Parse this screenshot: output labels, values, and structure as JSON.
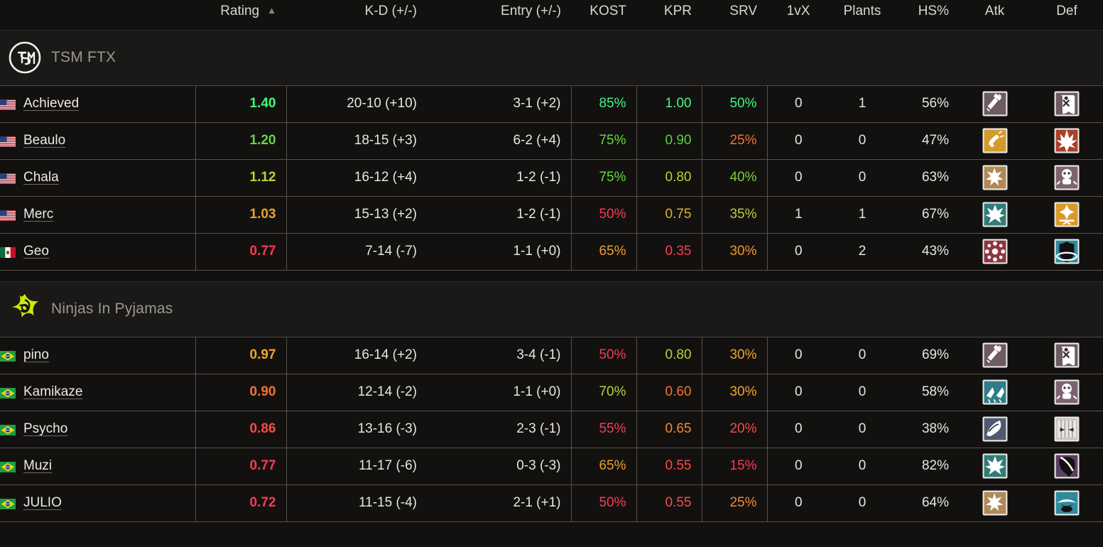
{
  "header": {
    "columns": [
      {
        "key": "player",
        "label": "",
        "align": "left"
      },
      {
        "key": "rating",
        "label": "Rating",
        "align": "right",
        "sorted": true,
        "sort_caret": "▲"
      },
      {
        "key": "kd",
        "label": "K-D (+/-)",
        "align": "right"
      },
      {
        "key": "entry",
        "label": "Entry (+/-)",
        "align": "right"
      },
      {
        "key": "kost",
        "label": "KOST",
        "align": "right"
      },
      {
        "key": "kpr",
        "label": "KPR",
        "align": "right"
      },
      {
        "key": "srv",
        "label": "SRV",
        "align": "right"
      },
      {
        "key": "onevx",
        "label": "1vX",
        "align": "center"
      },
      {
        "key": "plants",
        "label": "Plants",
        "align": "center"
      },
      {
        "key": "hs",
        "label": "HS%",
        "align": "right"
      },
      {
        "key": "atk",
        "label": "Atk",
        "align": "center"
      },
      {
        "key": "def",
        "label": "Def",
        "align": "center"
      }
    ]
  },
  "colors": {
    "rating_excellent": "#3ff97f",
    "rating_great": "#5fd93f",
    "rating_good": "#b9d138",
    "rating_average": "#e8a32a",
    "rating_poor": "#fa3a52",
    "text_default": "#e8e6e2",
    "background": "#131110",
    "border": "#56524b",
    "team_band": "#1a1918",
    "nip_green": "#cfe80b"
  },
  "teams": [
    {
      "name": "TSM FTX",
      "logo": "tsm-logo",
      "players": [
        {
          "name": "Achieved",
          "flag": "us",
          "flag_label": "United States",
          "rating": "1.40",
          "rating_color": "#3ff97f",
          "kd": "20-10 (+10)",
          "entry": "3-1 (+2)",
          "kost": "85%",
          "kost_color": "#3ff97f",
          "kpr": "1.00",
          "kpr_color": "#3ff97f",
          "srv": "50%",
          "srv_color": "#3ff97f",
          "onevx": "0",
          "plants": "1",
          "hs": "56%",
          "atk_op": "sledge",
          "def_op": "mute"
        },
        {
          "name": "Beaulo",
          "flag": "us",
          "flag_label": "United States",
          "rating": "1.20",
          "rating_color": "#5fd93f",
          "kd": "18-15 (+3)",
          "entry": "6-2 (+4)",
          "kost": "75%",
          "kost_color": "#5fd93f",
          "kpr": "0.90",
          "kpr_color": "#55d23f",
          "srv": "25%",
          "srv_color": "#f4722b",
          "onevx": "0",
          "plants": "0",
          "hs": "47%",
          "atk_op": "ash",
          "def_op": "goyo"
        },
        {
          "name": "Chala",
          "flag": "us",
          "flag_label": "United States",
          "rating": "1.12",
          "rating_color": "#b9d138",
          "kd": "16-12 (+4)",
          "entry": "1-2 (-1)",
          "kost": "75%",
          "kost_color": "#5fd93f",
          "kpr": "0.80",
          "kpr_color": "#b9d138",
          "srv": "40%",
          "srv_color": "#7fcb3c",
          "onevx": "0",
          "plants": "0",
          "hs": "63%",
          "atk_op": "hibana",
          "def_op": "smoke"
        },
        {
          "name": "Merc",
          "flag": "us",
          "flag_label": "United States",
          "rating": "1.03",
          "rating_color": "#e8a32a",
          "kd": "15-13 (+2)",
          "entry": "1-2 (-1)",
          "kost": "50%",
          "kost_color": "#fa3a52",
          "kpr": "0.75",
          "kpr_color": "#e0b02c",
          "srv": "35%",
          "srv_color": "#c5c936",
          "onevx": "1",
          "plants": "1",
          "hs": "67%",
          "atk_op": "nomad",
          "def_op": "ela"
        },
        {
          "name": "Geo",
          "flag": "mx",
          "flag_label": "Mexico",
          "rating": "0.77",
          "rating_color": "#fa3a52",
          "kd": "7-14 (-7)",
          "entry": "1-1 (+0)",
          "kost": "65%",
          "kost_color": "#eda02a",
          "kpr": "0.35",
          "kpr_color": "#fa3a52",
          "srv": "30%",
          "srv_color": "#f0962b",
          "onevx": "0",
          "plants": "2",
          "hs": "43%",
          "atk_op": "fuze",
          "def_op": "clash"
        }
      ]
    },
    {
      "name": "Ninjas In Pyjamas",
      "logo": "nip-logo",
      "players": [
        {
          "name": "pino",
          "flag": "br",
          "flag_label": "Brazil",
          "rating": "0.97",
          "rating_color": "#f0a52a",
          "kd": "16-14 (+2)",
          "entry": "3-4 (-1)",
          "kost": "50%",
          "kost_color": "#fa3a52",
          "kpr": "0.80",
          "kpr_color": "#b9d138",
          "srv": "30%",
          "srv_color": "#f0a52a",
          "onevx": "0",
          "plants": "0",
          "hs": "69%",
          "atk_op": "sledge",
          "def_op": "mute"
        },
        {
          "name": "Kamikaze",
          "flag": "br",
          "flag_label": "Brazil",
          "rating": "0.90",
          "rating_color": "#f9712b",
          "kd": "12-14 (-2)",
          "entry": "1-1 (+0)",
          "kost": "70%",
          "kost_color": "#b9d138",
          "kpr": "0.60",
          "kpr_color": "#f9712b",
          "srv": "30%",
          "srv_color": "#f0a52a",
          "onevx": "0",
          "plants": "0",
          "hs": "58%",
          "atk_op": "iq",
          "def_op": "smoke"
        },
        {
          "name": "Psycho",
          "flag": "br",
          "flag_label": "Brazil",
          "rating": "0.86",
          "rating_color": "#fa4a45",
          "kd": "13-16 (-3)",
          "entry": "2-3 (-1)",
          "kost": "55%",
          "kost_color": "#fa3a52",
          "kpr": "0.65",
          "kpr_color": "#f98a2b",
          "srv": "20%",
          "srv_color": "#fa4a45",
          "onevx": "0",
          "plants": "0",
          "hs": "38%",
          "atk_op": "dokkaebi",
          "def_op": "maestro"
        },
        {
          "name": "Muzi",
          "flag": "br",
          "flag_label": "Brazil",
          "rating": "0.77",
          "rating_color": "#fa3a52",
          "kd": "11-17 (-6)",
          "entry": "0-3 (-3)",
          "kost": "65%",
          "kost_color": "#eda02a",
          "kpr": "0.55",
          "kpr_color": "#fa4a45",
          "srv": "15%",
          "srv_color": "#fa3a52",
          "onevx": "0",
          "plants": "0",
          "hs": "82%",
          "atk_op": "nomad",
          "def_op": "caveira"
        },
        {
          "name": "JULIO",
          "flag": "br",
          "flag_label": "Brazil",
          "rating": "0.72",
          "rating_color": "#fa3a52",
          "kd": "11-15 (-4)",
          "entry": "2-1 (+1)",
          "kost": "50%",
          "kost_color": "#fa3a52",
          "kpr": "0.55",
          "kpr_color": "#fa4a45",
          "srv": "25%",
          "srv_color": "#f98a2b",
          "onevx": "0",
          "plants": "0",
          "hs": "64%",
          "atk_op": "hibana",
          "def_op": "jager"
        }
      ]
    }
  ]
}
